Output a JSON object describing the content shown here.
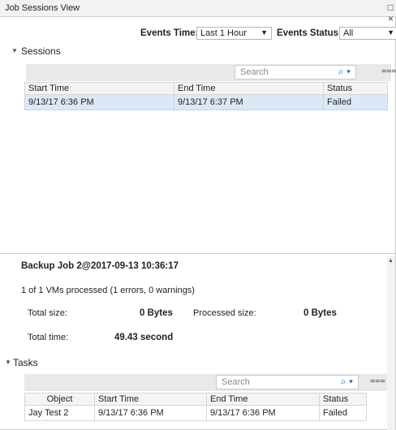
{
  "window": {
    "title": "Job Sessions View",
    "restore_glyph": "□ ×"
  },
  "filters": {
    "events_time_label": "Events Time:",
    "events_time_value": "Last 1 Hour",
    "events_status_label": "Events Status:",
    "events_status_value": "All"
  },
  "sessions": {
    "header": "Sessions",
    "search_placeholder": "Search",
    "columns": [
      "Start Time",
      "End Time",
      "Status"
    ],
    "rows": [
      [
        "9/13/17 6:36 PM",
        "9/13/17 6:37 PM",
        "Failed"
      ]
    ]
  },
  "detail": {
    "title": "Backup Job 2@2017-09-13 10:36:17",
    "summary": "1 of 1 VMs processed (1 errors, 0 warnings)",
    "total_size_label": "Total size:",
    "total_size_value": "0 Bytes",
    "processed_size_label": "Processed size:",
    "processed_size_value": "0 Bytes",
    "total_time_label": "Total time:",
    "total_time_value": "49.43 second"
  },
  "tasks": {
    "header": "Tasks",
    "search_placeholder": "Search",
    "columns": [
      "Object",
      "Start Time",
      "End Time",
      "Status"
    ],
    "rows": [
      [
        "Jay Test 2",
        "9/13/17 6:36 PM",
        "9/13/17 6:36 PM",
        "Failed"
      ]
    ]
  },
  "icons": {
    "search": "search-icon",
    "column-chooser": "column-chooser-icon",
    "dropdown": "chevron-down-icon"
  }
}
